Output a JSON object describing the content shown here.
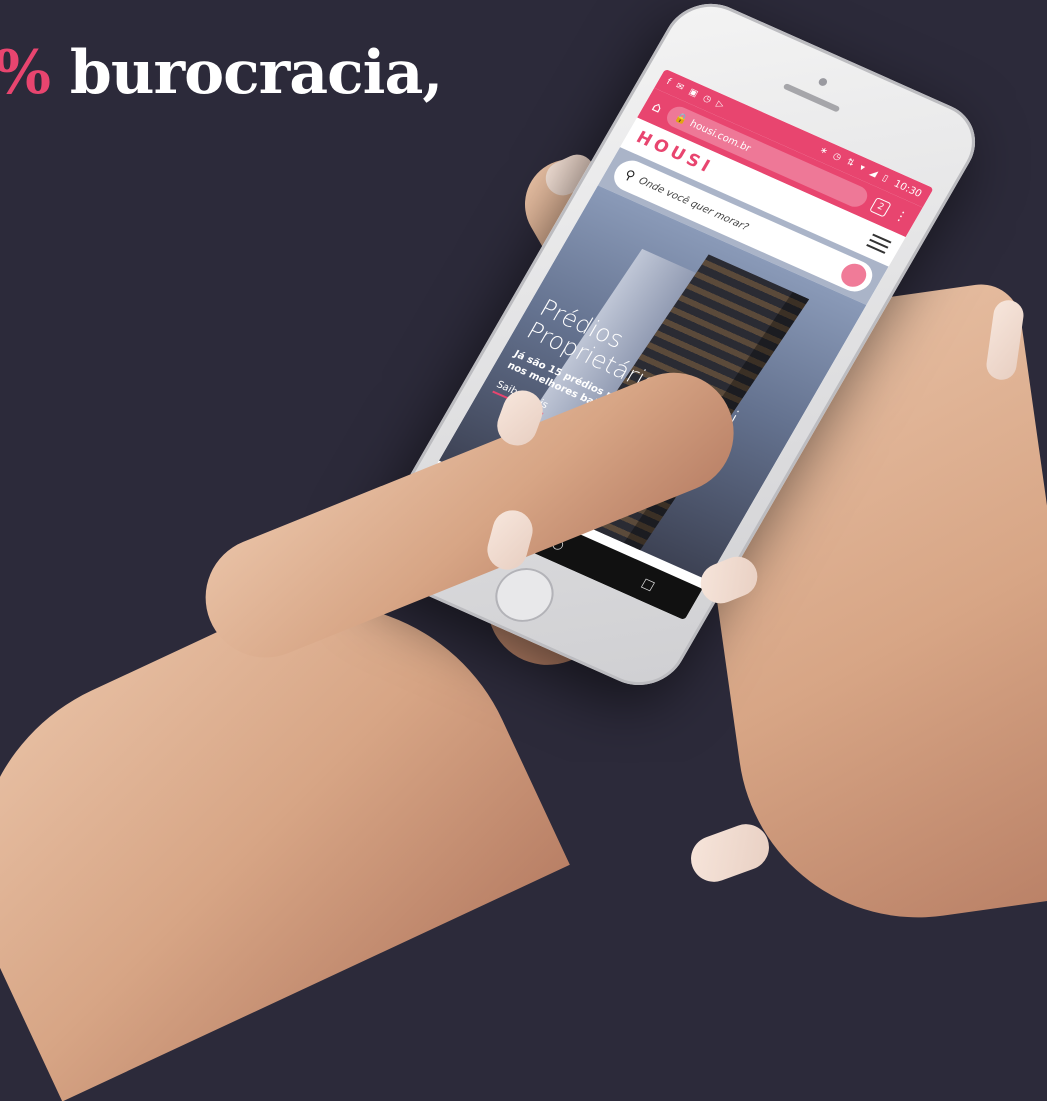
{
  "headline": {
    "prefix": "%",
    "rest": " burocracia,"
  },
  "phone": {
    "status": {
      "icons_left": "f ✉ ▣ ◷ ▷",
      "icons_right": "∗ ◷ ⇅ ▾ ◢ ▯",
      "time": "10:30"
    },
    "browser": {
      "url": "housi.com.br",
      "tabs_count": "2"
    },
    "site": {
      "logo": "HOUSI",
      "search_placeholder": "Onde você quer morar?",
      "hero": {
        "title_line1": "Prédios",
        "title_line2": "Proprietários Housi",
        "subtitle_line1": "Já são 15 prédios proprietários",
        "subtitle_line2": "nos melhores bairros de SP",
        "link": "Saiba mais"
      }
    },
    "nav": {
      "back": "◁",
      "home": "○",
      "recent": "□"
    }
  },
  "colors": {
    "brand": "#e8456f",
    "background": "#2c2a3a"
  }
}
